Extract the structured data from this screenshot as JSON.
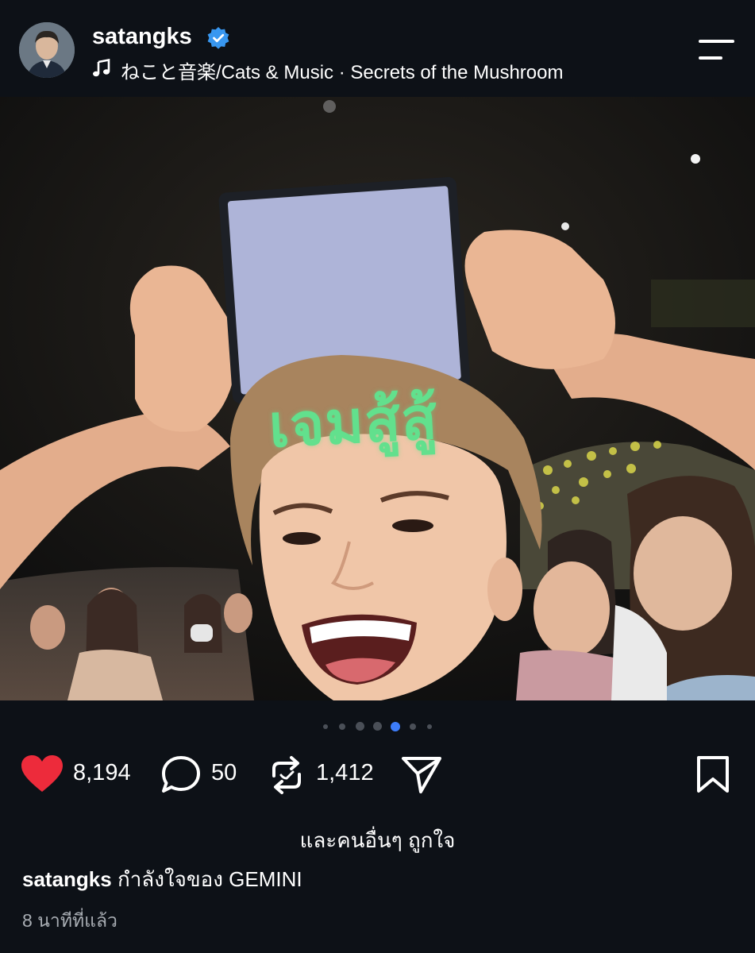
{
  "header": {
    "username": "satangks",
    "music": "ねこと音楽/Cats & Music · Secrets of the Mushroom",
    "icons": {
      "verified": "verified-badge-icon",
      "music": "music-note-icon",
      "menu": "menu-icon"
    },
    "verified_color": "#3897f0"
  },
  "media": {
    "sign_text": "เจมสู้สู้",
    "icons": {
      "mute": "volume-muted-icon"
    },
    "pager": {
      "count": 7,
      "active_index": 4
    }
  },
  "actions": {
    "like_count": "8,194",
    "comment_count": "50",
    "repost_count": "1,412",
    "icons": [
      "heart-icon",
      "comment-icon",
      "repost-icon",
      "share-icon",
      "bookmark-icon"
    ],
    "like_color": "#ed2b3b"
  },
  "caption": {
    "liked_by": "และคนอื่นๆ ถูกใจ",
    "username": "satangks",
    "text": "กำลังใจของ GEMINI",
    "time": "8 นาทีที่แล้ว"
  }
}
